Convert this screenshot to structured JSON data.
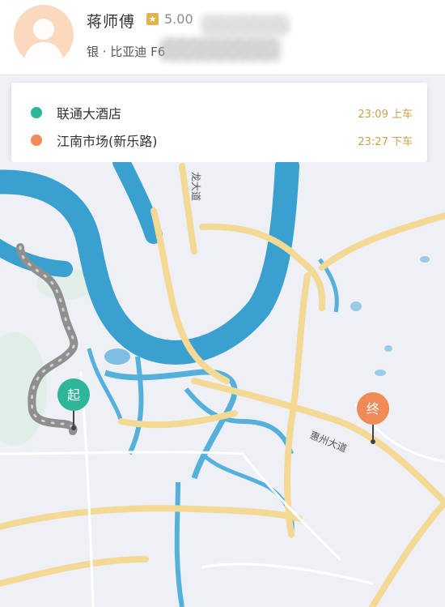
{
  "driver": {
    "name": "蒋师傅",
    "rating": "5.00",
    "car_info": "银 · 比亚迪 F6"
  },
  "route": [
    {
      "place": "联通大酒店",
      "time": "23:09",
      "action": "上车",
      "color": "#2fb59a"
    },
    {
      "place": "江南市场(新乐路)",
      "time": "23:27",
      "action": "下车",
      "color": "#f08a57"
    }
  ],
  "map": {
    "road_labels": [
      "龙大道",
      "惠州大道"
    ],
    "start_marker": "起",
    "end_marker": "终",
    "colors": {
      "water": "#3aa0d0",
      "land": "#eef0f6",
      "major_road": "#f4d995",
      "route": "#9a9a9a",
      "start": "#2fb59a",
      "end": "#f08a57"
    }
  }
}
